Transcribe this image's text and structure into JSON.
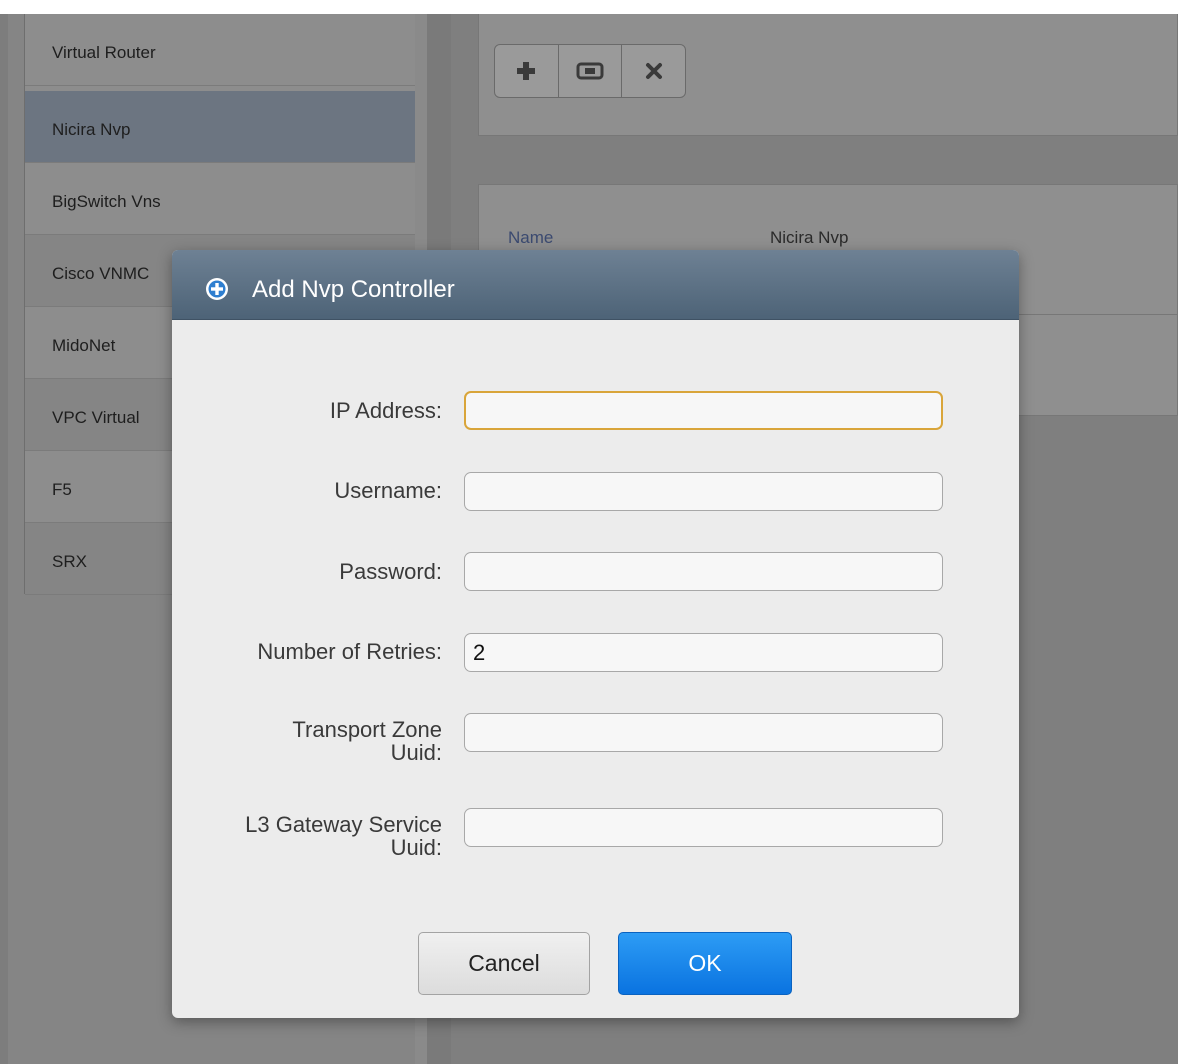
{
  "sidebar": {
    "items": [
      {
        "label": "Virtual Router"
      },
      {
        "label": "Nicira Nvp"
      },
      {
        "label": "BigSwitch Vns"
      },
      {
        "label": "Cisco VNMC"
      },
      {
        "label": "MidoNet"
      },
      {
        "label": "VPC Virtual"
      },
      {
        "label": "F5"
      },
      {
        "label": "SRX"
      }
    ],
    "selected": "Nicira Nvp"
  },
  "toolbar": {
    "icons": [
      "add-icon",
      "switch-icon",
      "remove-icon"
    ]
  },
  "details": {
    "name_label": "Name",
    "name_value": "Nicira Nvp"
  },
  "dialog": {
    "title": "Add Nvp Controller",
    "icon": "plus-circle-icon",
    "fields": {
      "ip_address": {
        "label": "IP Address:",
        "value": ""
      },
      "username": {
        "label": "Username:",
        "value": ""
      },
      "password": {
        "label": "Password:",
        "value": ""
      },
      "retries": {
        "label": "Number of Retries:",
        "value": "2"
      },
      "transport_zone": {
        "label_line1": "Transport Zone",
        "label_line2": "Uuid:",
        "value": ""
      },
      "l3_gateway": {
        "label_line1": "L3 Gateway Service",
        "label_line2": "Uuid:",
        "value": ""
      }
    },
    "cancel_label": "Cancel",
    "ok_label": "OK"
  },
  "colors": {
    "dialog_header": "#5a6e82",
    "ok_button": "#1a86ec",
    "focus_border": "#d9a53a"
  }
}
